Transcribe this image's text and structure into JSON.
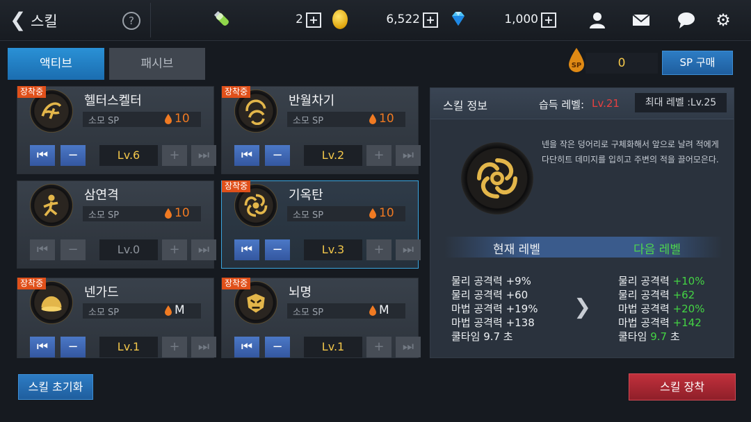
{
  "header": {
    "title": "스킬",
    "stamina_value": "2",
    "gold_value": "6,522",
    "gem_value": "1,000"
  },
  "tabs": [
    {
      "label": "액티브",
      "active": true
    },
    {
      "label": "패시브",
      "active": false
    }
  ],
  "sp": {
    "value": "0",
    "icon_text": "SP",
    "buy_label": "SP 구매"
  },
  "skills": [
    {
      "name": "헬터스켈터",
      "equipped": true,
      "badge": "장착중",
      "cost_label": "소모 SP",
      "cost": "10",
      "level": "Lv.6",
      "enabled": true
    },
    {
      "name": "반월차기",
      "equipped": true,
      "badge": "장착중",
      "cost_label": "소모 SP",
      "cost": "10",
      "level": "Lv.2",
      "enabled": true
    },
    {
      "name": "삼연격",
      "equipped": false,
      "badge": "",
      "cost_label": "소모 SP",
      "cost": "10",
      "level": "Lv.0",
      "enabled": false
    },
    {
      "name": "기옥탄",
      "equipped": true,
      "badge": "장착중",
      "cost_label": "소모 SP",
      "cost": "10",
      "level": "Lv.3",
      "enabled": true,
      "selected": true
    },
    {
      "name": "넨가드",
      "equipped": true,
      "badge": "장착중",
      "cost_label": "소모 SP",
      "cost": "M",
      "level": "Lv.1",
      "enabled": true
    },
    {
      "name": "뇌명",
      "equipped": true,
      "badge": "장착중",
      "cost_label": "소모 SP",
      "cost": "M",
      "level": "Lv.1",
      "enabled": true
    }
  ],
  "info": {
    "title": "스킬 정보",
    "learn_label": "습득 레벨:",
    "learn_level": "Lv.21",
    "max_level": "최대 레벨 :Lv.25",
    "description": "넨을 작은 덩어리로 구체화해서 앞으로 날려 적에게 다단히트 데미지를 입히고 주변의 적을 끌어모은다.",
    "current_header": "현재 레벨",
    "next_header": "다음 레벨",
    "current_stats": [
      {
        "label": "물리 공격력",
        "value": "+9%"
      },
      {
        "label": "물리 공격력",
        "value": "+60"
      },
      {
        "label": "마법 공격력",
        "value": "+19%"
      },
      {
        "label": "마법 공격력",
        "value": "+138"
      },
      {
        "label": "쿨타임",
        "value": "9.7 초"
      }
    ],
    "next_stats": [
      {
        "label": "물리 공격력",
        "value": "+10%"
      },
      {
        "label": "물리 공격력",
        "value": "+62"
      },
      {
        "label": "마법 공격력",
        "value": "+20%"
      },
      {
        "label": "마법 공격력",
        "value": "+142"
      },
      {
        "label": "쿨타임",
        "value": "9.7",
        "unit": "초"
      }
    ]
  },
  "buttons": {
    "reset": "스킬 초기화",
    "equip": "스킬 장착"
  },
  "colors": {
    "accent_blue": "#2a91d6",
    "equip_red": "#b62a36",
    "level_gold": "#f3c74a",
    "next_green": "#44d444",
    "badge_orange": "#e0501a"
  }
}
